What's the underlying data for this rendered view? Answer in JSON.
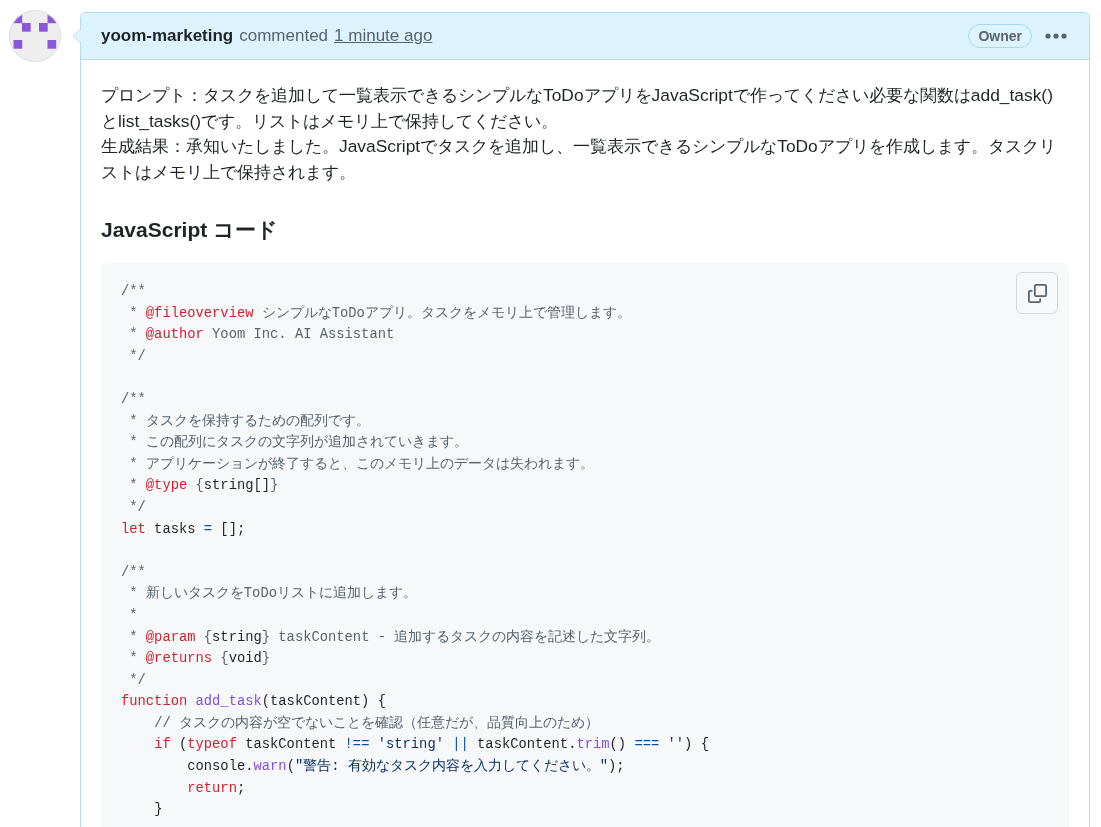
{
  "comment": {
    "author": "yoom-marketing",
    "action": "commented",
    "time": "1 minute ago",
    "role": "Owner",
    "paragraphs": [
      "プロンプト：タスクを追加して一覧表示できるシンプルなToDoアプリをJavaScriptで作ってください必要な関数はadd_task()とlist_tasks()です。リストはメモリ上で保持してください。",
      "生成結果：承知いたしました。JavaScriptでタスクを追加し、一覧表示できるシンプルなToDoアプリを作成します。タスクリストはメモリ上で保持されます。"
    ],
    "heading": "JavaScript コード",
    "code_lines": [
      {
        "kind": "code",
        "tokens": [
          {
            "kind": "comment",
            "text": "/**"
          }
        ]
      },
      {
        "kind": "code",
        "tokens": [
          {
            "kind": "comment",
            "text": " * "
          },
          {
            "kind": "keyword",
            "text": "@fileoverview"
          },
          {
            "kind": "comment",
            "text": " シンプルなToDoアプリ。タスクをメモリ上で管理します。"
          }
        ]
      },
      {
        "kind": "code",
        "tokens": [
          {
            "kind": "comment",
            "text": " * "
          },
          {
            "kind": "keyword",
            "text": "@author"
          },
          {
            "kind": "comment",
            "text": " Yoom Inc. AI Assistant"
          }
        ]
      },
      {
        "kind": "code",
        "tokens": [
          {
            "kind": "comment",
            "text": " */"
          }
        ]
      },
      {
        "kind": "blank"
      },
      {
        "kind": "code",
        "tokens": [
          {
            "kind": "comment",
            "text": "/**"
          }
        ]
      },
      {
        "kind": "code",
        "tokens": [
          {
            "kind": "comment",
            "text": " * タスクを保持するための配列です。"
          }
        ]
      },
      {
        "kind": "code",
        "tokens": [
          {
            "kind": "comment",
            "text": " * この配列にタスクの文字列が追加されていきます。"
          }
        ]
      },
      {
        "kind": "code",
        "tokens": [
          {
            "kind": "comment",
            "text": " * アプリケーションが終了すると、このメモリ上のデータは失われます。"
          }
        ]
      },
      {
        "kind": "code",
        "tokens": [
          {
            "kind": "comment",
            "text": " * "
          },
          {
            "kind": "keyword",
            "text": "@type"
          },
          {
            "kind": "comment",
            "text": " {"
          },
          {
            "kind": "plain",
            "text": "string[]"
          },
          {
            "kind": "comment",
            "text": "}"
          }
        ]
      },
      {
        "kind": "code",
        "tokens": [
          {
            "kind": "comment",
            "text": " */"
          }
        ]
      },
      {
        "kind": "code",
        "tokens": [
          {
            "kind": "keyword",
            "text": "let"
          },
          {
            "kind": "plain",
            "text": " tasks "
          },
          {
            "kind": "operator",
            "text": "="
          },
          {
            "kind": "plain",
            "text": " [];"
          }
        ]
      },
      {
        "kind": "blank"
      },
      {
        "kind": "code",
        "tokens": [
          {
            "kind": "comment",
            "text": "/**"
          }
        ]
      },
      {
        "kind": "code",
        "tokens": [
          {
            "kind": "comment",
            "text": " * 新しいタスクをToDoリストに追加します。"
          }
        ]
      },
      {
        "kind": "code",
        "tokens": [
          {
            "kind": "comment",
            "text": " *"
          }
        ]
      },
      {
        "kind": "code",
        "tokens": [
          {
            "kind": "comment",
            "text": " * "
          },
          {
            "kind": "keyword",
            "text": "@param"
          },
          {
            "kind": "comment",
            "text": " {"
          },
          {
            "kind": "plain",
            "text": "string"
          },
          {
            "kind": "comment",
            "text": "} taskContent - 追加するタスクの内容を記述した文字列。"
          }
        ]
      },
      {
        "kind": "code",
        "tokens": [
          {
            "kind": "comment",
            "text": " * "
          },
          {
            "kind": "keyword",
            "text": "@returns"
          },
          {
            "kind": "comment",
            "text": " {"
          },
          {
            "kind": "plain",
            "text": "void"
          },
          {
            "kind": "comment",
            "text": "}"
          }
        ]
      },
      {
        "kind": "code",
        "tokens": [
          {
            "kind": "comment",
            "text": " */"
          }
        ]
      },
      {
        "kind": "code",
        "tokens": [
          {
            "kind": "keyword",
            "text": "function "
          },
          {
            "kind": "function",
            "text": "add_task"
          },
          {
            "kind": "plain",
            "text": "(taskContent) {"
          }
        ]
      },
      {
        "kind": "code",
        "tokens": [
          {
            "kind": "comment",
            "text": "    // タスクの内容が空でないことを確認（任意だが、品質向上のため）"
          }
        ]
      },
      {
        "kind": "code",
        "tokens": [
          {
            "kind": "keyword",
            "text": "    if"
          },
          {
            "kind": "plain",
            "text": " ("
          },
          {
            "kind": "keyword",
            "text": "typeof"
          },
          {
            "kind": "plain",
            "text": " taskContent "
          },
          {
            "kind": "operator",
            "text": "!== "
          },
          {
            "kind": "string",
            "text": "'string'"
          },
          {
            "kind": "operator",
            "text": " || "
          },
          {
            "kind": "plain",
            "text": "taskContent."
          },
          {
            "kind": "function",
            "text": "trim"
          },
          {
            "kind": "plain",
            "text": "() "
          },
          {
            "kind": "operator",
            "text": "=== "
          },
          {
            "kind": "string",
            "text": "''"
          },
          {
            "kind": "plain",
            "text": ") {"
          }
        ]
      },
      {
        "kind": "code",
        "tokens": [
          {
            "kind": "plain",
            "text": "        console."
          },
          {
            "kind": "function",
            "text": "warn"
          },
          {
            "kind": "plain",
            "text": "("
          },
          {
            "kind": "string",
            "text": "\"警告: 有効なタスク内容を入力してください。\""
          },
          {
            "kind": "plain",
            "text": ");"
          }
        ]
      },
      {
        "kind": "code",
        "tokens": [
          {
            "kind": "keyword",
            "text": "        return"
          },
          {
            "kind": "plain",
            "text": ";"
          }
        ]
      },
      {
        "kind": "code",
        "tokens": [
          {
            "kind": "plain",
            "text": "    }"
          }
        ]
      }
    ]
  }
}
